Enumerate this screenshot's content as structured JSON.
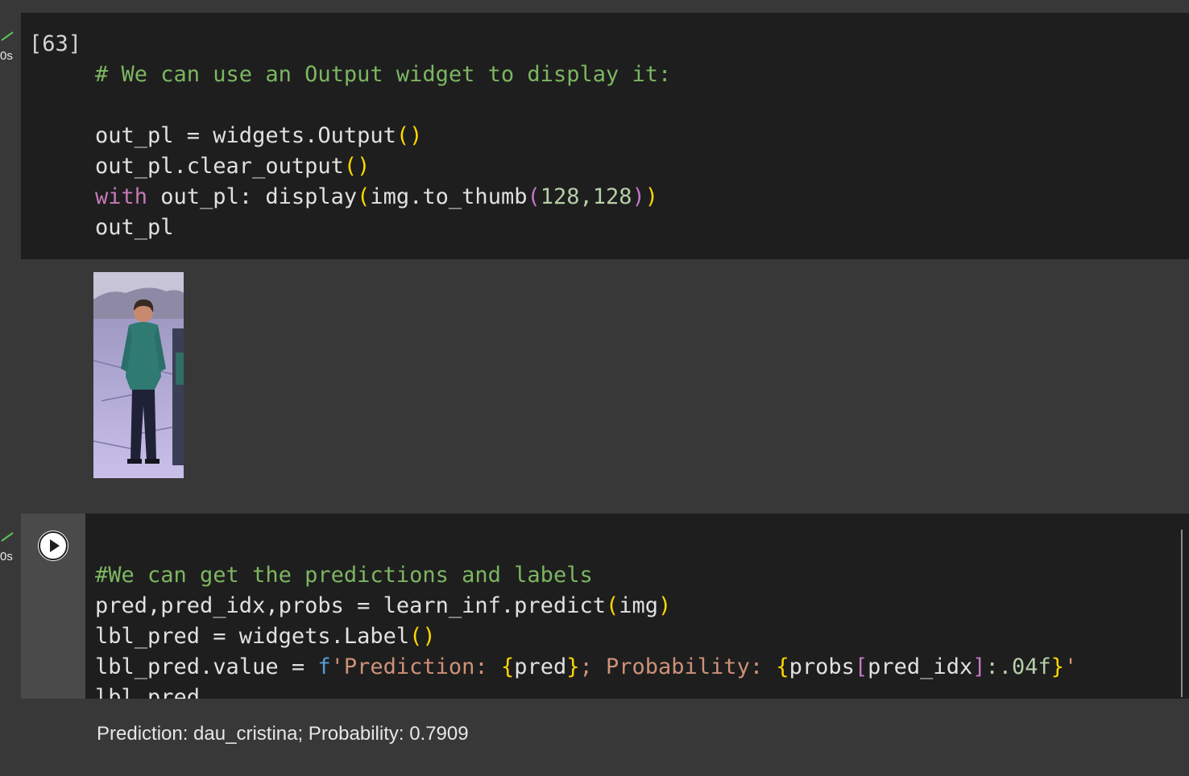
{
  "cell1": {
    "execution_count": "[63]",
    "runtime": "0s",
    "comment": "# We can use an Output widget to display it:",
    "line2_a": "out_pl = widgets.Output",
    "line3_a": "out_pl.clear_output",
    "line4_kw": "with",
    "line4_a": " out_pl: display",
    "line4_b": "img.to_thumb",
    "line4_c": "128,128",
    "line5": "out_pl"
  },
  "output1": {
    "image_icon": "thumbnail-image"
  },
  "cell2": {
    "runtime": "0s",
    "run_icon": "play-icon",
    "comment": "#We can get the predictions and labels",
    "line2_a": "pred,pred_idx,probs = learn_inf.predict",
    "line2_b": "img",
    "line3_a": "lbl_pred = widgets.Label",
    "line4_a": "lbl_pred.value = ",
    "line4_fprefix": "f",
    "line4_s1": "'Prediction: ",
    "line4_b1": "pred",
    "line4_s2": "; Probability: ",
    "line4_b2a": "probs",
    "line4_b2b": "pred_idx",
    "line4_fmt": ":.04f",
    "line4_s3": "'",
    "line5": "lbl_pred"
  },
  "output2": {
    "label_text": "Prediction: dau_cristina; Probability: 0.7909"
  },
  "colors": {
    "cell_bg": "#1e1e1e",
    "page_bg": "#383838",
    "comment": "#7cb661",
    "keyword": "#c678b8",
    "string": "#ce9178",
    "number": "#b5cea8",
    "bracket": "#ffd700"
  }
}
